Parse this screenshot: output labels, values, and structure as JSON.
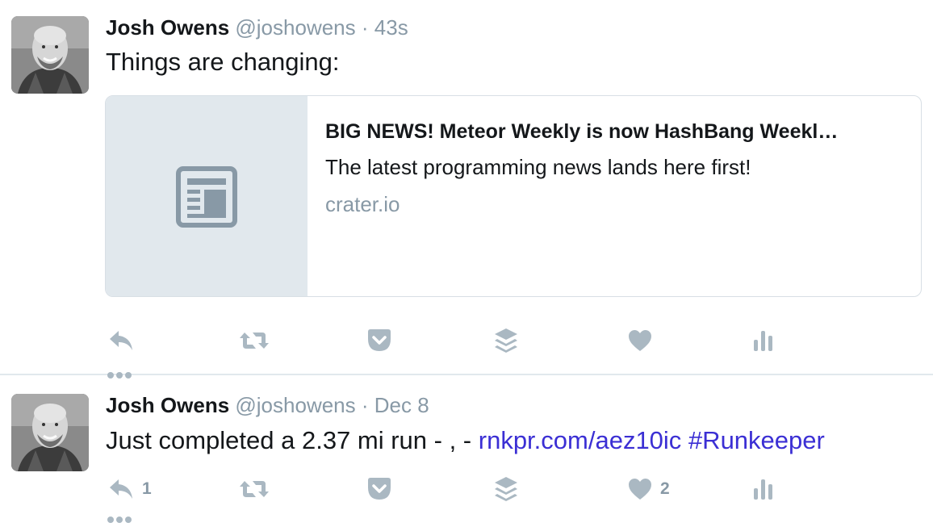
{
  "tweets": [
    {
      "author_name": "Josh Owens",
      "handle": "@joshowens",
      "separator": "·",
      "time": "43s",
      "text": "Things are changing:",
      "card": {
        "title": "BIG NEWS! Meteor Weekly is now HashBang Weekl…",
        "description": "The latest programming news lands here first!",
        "domain": "crater.io"
      },
      "reply_count": "",
      "like_count": ""
    },
    {
      "author_name": "Josh Owens",
      "handle": "@joshowens",
      "separator": "·",
      "time": "Dec 8",
      "text": "Just completed a 2.37 mi run - , - ",
      "link": "rnkpr.com/aez10ic",
      "hashtag": "#Runkeeper",
      "reply_count": "1",
      "like_count": "2"
    }
  ],
  "icons": [
    "reply-icon",
    "retweet-icon",
    "pocket-icon",
    "buffer-icon",
    "like-icon",
    "analytics-icon",
    "more-icon",
    "article-icon"
  ],
  "colors": {
    "icon_gray": "#aab8c2",
    "meta_gray": "#8899a6",
    "link": "#3b2fd4",
    "card_thumb": "#e1e8ed"
  }
}
